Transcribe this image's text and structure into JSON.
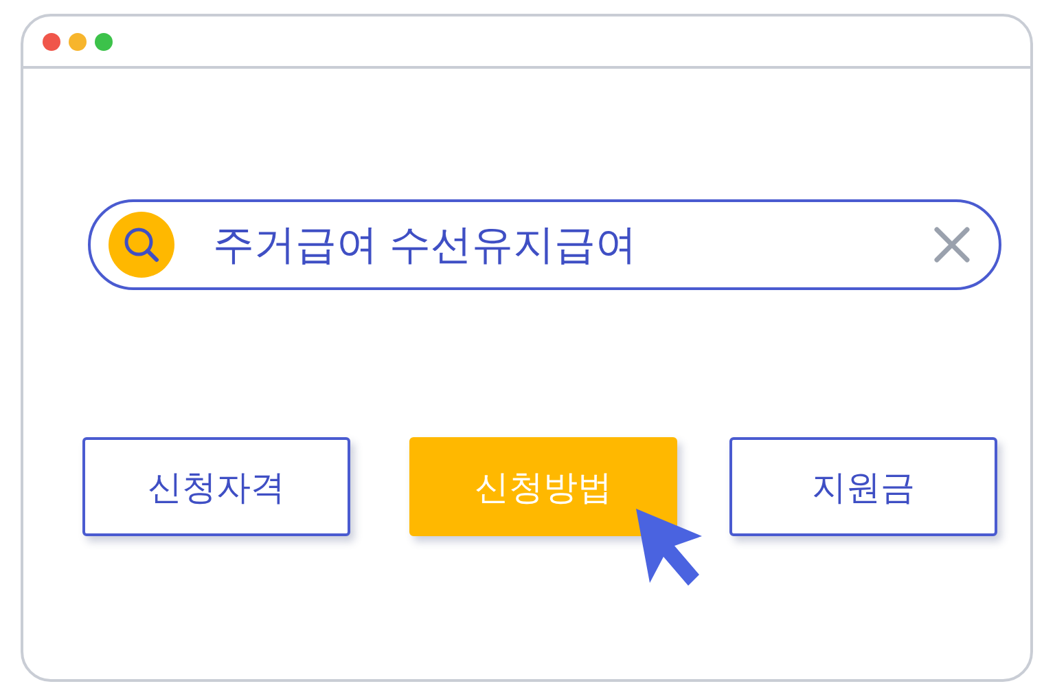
{
  "search": {
    "value": "주거급여 수선유지급여"
  },
  "buttons": [
    {
      "label": "신청자격",
      "selected": false
    },
    {
      "label": "신청방법",
      "selected": true
    },
    {
      "label": "지원금",
      "selected": false
    }
  ]
}
